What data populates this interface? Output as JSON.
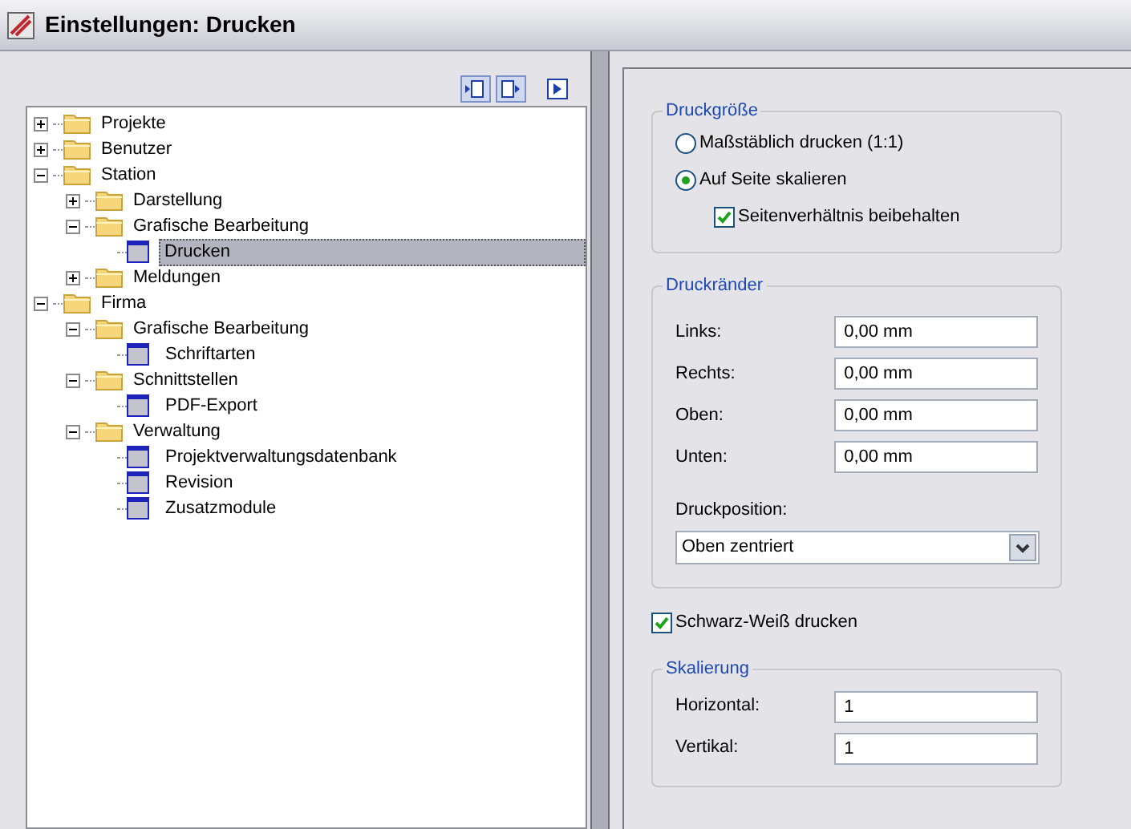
{
  "window": {
    "title": "Einstellungen: Drucken"
  },
  "tree": [
    {
      "label": "Projekte",
      "kind": "folder",
      "expanded": false,
      "selected": false
    },
    {
      "label": "Benutzer",
      "kind": "folder",
      "expanded": false,
      "selected": false
    },
    {
      "label": "Station",
      "kind": "folder",
      "expanded": true,
      "selected": false,
      "children": [
        {
          "label": "Darstellung",
          "kind": "folder",
          "expanded": false,
          "selected": false
        },
        {
          "label": "Grafische Bearbeitung",
          "kind": "folder",
          "expanded": true,
          "selected": false,
          "children": [
            {
              "label": "Drucken",
              "kind": "page",
              "selected": true
            }
          ]
        },
        {
          "label": "Meldungen",
          "kind": "folder",
          "expanded": false,
          "selected": false
        }
      ]
    },
    {
      "label": "Firma",
      "kind": "folder",
      "expanded": true,
      "selected": false,
      "children": [
        {
          "label": "Grafische Bearbeitung",
          "kind": "folder",
          "expanded": true,
          "selected": false,
          "children": [
            {
              "label": "Schriftarten",
              "kind": "page",
              "selected": false
            }
          ]
        },
        {
          "label": "Schnittstellen",
          "kind": "folder",
          "expanded": true,
          "selected": false,
          "children": [
            {
              "label": "PDF-Export",
              "kind": "page",
              "selected": false
            }
          ]
        },
        {
          "label": "Verwaltung",
          "kind": "folder",
          "expanded": true,
          "selected": false,
          "children": [
            {
              "label": "Projektverwaltungsdatenbank",
              "kind": "page",
              "selected": false
            },
            {
              "label": "Revision",
              "kind": "page",
              "selected": false
            },
            {
              "label": "Zusatzmodule",
              "kind": "page",
              "selected": false
            }
          ]
        }
      ]
    }
  ],
  "druckgroesse": {
    "title": "Druckgröße",
    "options": [
      {
        "label": "Maßstäblich drucken (1:1)",
        "selected": false
      },
      {
        "label": "Auf Seite skalieren",
        "selected": true
      }
    ],
    "keep_ratio": {
      "label": "Seitenverhältnis beibehalten",
      "checked": true
    }
  },
  "druckraender": {
    "title": "Druckränder",
    "fields": [
      {
        "label": "Links:",
        "value": "0,00 mm"
      },
      {
        "label": "Rechts:",
        "value": "0,00 mm"
      },
      {
        "label": "Oben:",
        "value": "0,00 mm"
      },
      {
        "label": "Unten:",
        "value": "0,00 mm"
      }
    ],
    "position": {
      "label": "Druckposition:",
      "value": "Oben zentriert"
    }
  },
  "bw": {
    "label": "Schwarz-Weiß drucken",
    "checked": true
  },
  "skalierung": {
    "title": "Skalierung",
    "fields": [
      {
        "label": "Horizontal:",
        "value": "1"
      },
      {
        "label": "Vertikal:",
        "value": "1"
      }
    ]
  }
}
